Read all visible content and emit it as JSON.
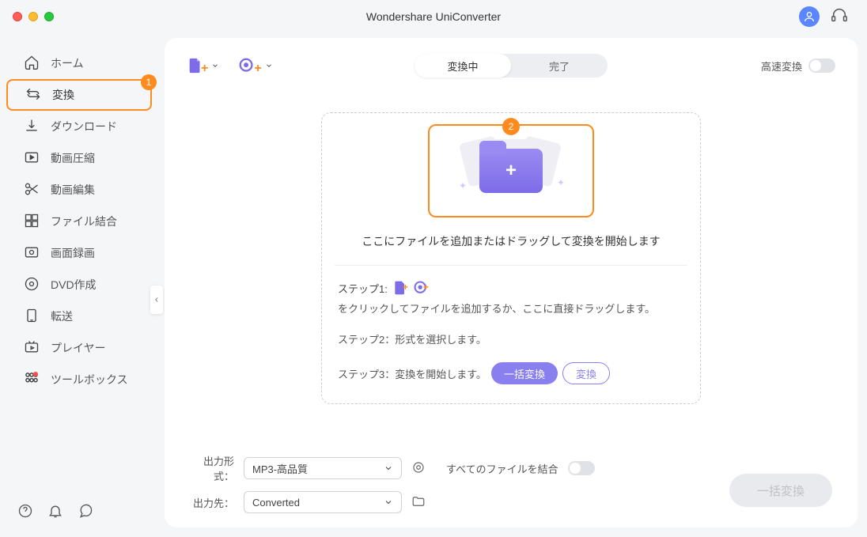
{
  "title": "Wondershare UniConverter",
  "nav": {
    "home": "ホーム",
    "convert": "変換",
    "download": "ダウンロード",
    "compress": "動画圧縮",
    "edit": "動画編集",
    "merge": "ファイル結合",
    "record": "画面録画",
    "dvd": "DVD作成",
    "transfer": "転送",
    "player": "プレイヤー",
    "toolbox": "ツールボックス"
  },
  "badge1": "1",
  "badge2": "2",
  "tabs": {
    "converting": "変換中",
    "done": "完了"
  },
  "hispeed": "高速変換",
  "dropText": "ここにファイルを追加またはドラッグして変換を開始します",
  "steps": {
    "s1a": "ステップ1:",
    "s1b": "をクリックしてファイルを追加するか、ここに直接ドラッグします。",
    "s2": "ステップ2：形式を選択します。",
    "s3": "ステップ3：変換を開始します。"
  },
  "buttons": {
    "batch": "一括変換",
    "convert": "変換"
  },
  "footer": {
    "outFormat": "出力形式：",
    "formatValue": "MP3-高品質",
    "outDest": "出力先：",
    "destValue": "Converted",
    "mergeAll": "すべてのファイルを結合"
  },
  "bigBtn": "一括変換"
}
